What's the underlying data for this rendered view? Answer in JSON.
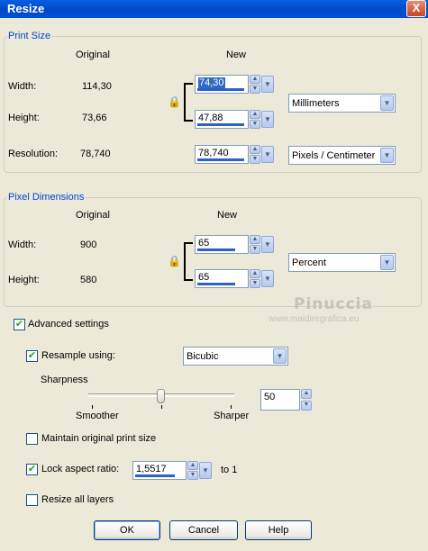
{
  "window": {
    "title": "Resize",
    "close_glyph": "X"
  },
  "print_size": {
    "group_label": "Print Size",
    "col_original": "Original",
    "col_new": "New",
    "width_label": "Width:",
    "width_original": "114,30",
    "width_new": "74,30",
    "height_label": "Height:",
    "height_original": "73,66",
    "height_new": "47,88",
    "resolution_label": "Resolution:",
    "resolution_original": "78,740",
    "resolution_new": "78,740",
    "unit_select": "Millimeters",
    "resolution_unit_select": "Pixels / Centimeter"
  },
  "pixel_dimensions": {
    "group_label": "Pixel Dimensions",
    "col_original": "Original",
    "col_new": "New",
    "width_label": "Width:",
    "width_original": "900",
    "width_new": "65",
    "height_label": "Height:",
    "height_original": "580",
    "height_new": "65",
    "unit_select": "Percent"
  },
  "watermark": {
    "name": "Pinuccia",
    "site": "www.maidiregrafica.eu"
  },
  "options": {
    "advanced_settings": "Advanced settings",
    "resample_using": "Resample using:",
    "resample_method": "Bicubic",
    "sharpness_label": "Sharpness",
    "sharpness_low": "Smoother",
    "sharpness_high": "Sharper",
    "sharpness_value": "50",
    "sharpness_level_percent": 50,
    "maintain_print_size": "Maintain original print size",
    "lock_aspect": "Lock aspect ratio:",
    "aspect_value": "1,5517",
    "aspect_suffix": "to 1",
    "resize_all_layers": "Resize all layers"
  },
  "checkboxes": {
    "advanced_settings": true,
    "resample_using": true,
    "maintain_print_size": false,
    "lock_aspect": true,
    "resize_all_layers": false
  },
  "buttons": {
    "ok": "OK",
    "cancel": "Cancel",
    "help": "Help"
  },
  "icons": {
    "lock": "lock-icon",
    "check": "checkmark-icon",
    "spin_up": "spin-up-icon",
    "spin_down": "spin-down-icon",
    "dropdown": "chevron-down-icon"
  },
  "colors": {
    "title_bar": "#0A5FE0",
    "group_label": "#0046D5",
    "dialog_bg": "#ECE9D8",
    "selection": "#316AC5"
  }
}
